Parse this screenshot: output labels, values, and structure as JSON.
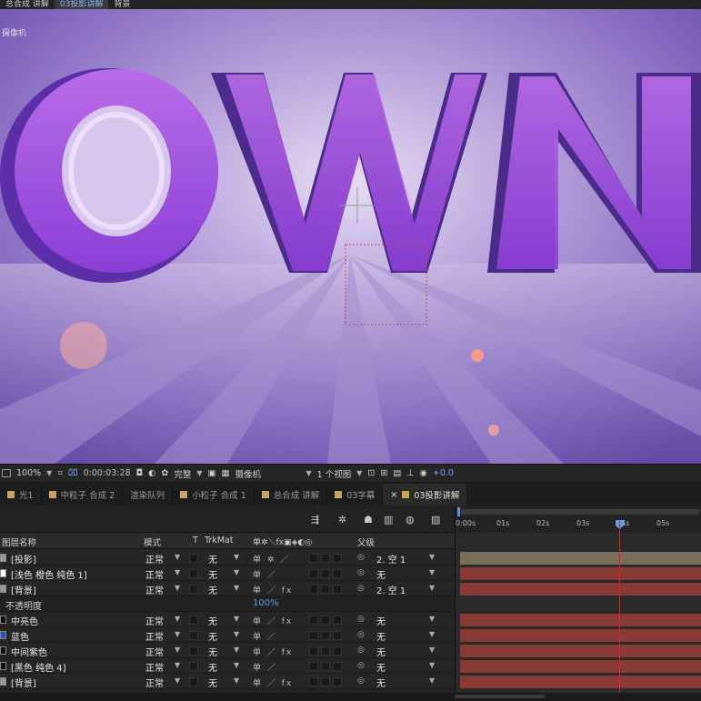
{
  "top_tabs": [
    "总合成 讲解",
    "03投影讲解",
    "背景"
  ],
  "viewer": {
    "label": "摄像机",
    "letters": "OWN"
  },
  "viewer_bar": {
    "zoom": "100%",
    "timecode": "0:00:03:28",
    "resolution": "完整",
    "camera": "摄像机",
    "views": "1 个视图",
    "exposure": "+0.0"
  },
  "tabs": [
    {
      "label": "光1",
      "color": "#c8a45a"
    },
    {
      "label": "中粒子 合成 2",
      "color": "#c8a45a"
    },
    {
      "label": "渲染队列",
      "color": ""
    },
    {
      "label": "小粒子 合成 1",
      "color": "#c8a45a"
    },
    {
      "label": "总合成 讲解",
      "color": "#c8a45a"
    },
    {
      "label": "03字幕",
      "color": "#c8a45a"
    },
    {
      "label": "03投影讲解",
      "color": "#c8a45a"
    }
  ],
  "layer_header": {
    "name": "图层名称",
    "mode": "模式",
    "t": "T",
    "trkmat": "TrkMat",
    "switches": "单✲＼fx▣◈◐◎",
    "parent": "父级"
  },
  "layers": [
    {
      "name": "[投影]",
      "mode": "正常",
      "trkmat": "无",
      "parent": "2. 空 1",
      "switches": "单 ✲ ／",
      "swatch": "#9a9a9a"
    },
    {
      "name": "[浅色 橙色 纯色 1]",
      "mode": "正常",
      "trkmat": "无",
      "parent": "无",
      "switches": "单 ／",
      "swatch": "#ffffff"
    },
    {
      "name": "[背景]",
      "mode": "正常",
      "trkmat": "无",
      "parent": "2. 空 1",
      "switches": "单 ／ fx",
      "swatch": "#9a9a9a"
    },
    {
      "name": "中亮色",
      "mode": "正常",
      "trkmat": "无",
      "parent": "无",
      "switches": "单 ／ fx",
      "swatch": "#111111"
    },
    {
      "name": "蓝色",
      "mode": "正常",
      "trkmat": "无",
      "parent": "无",
      "switches": "单 ／",
      "swatch": "#3050c8"
    },
    {
      "name": "中间紫色",
      "mode": "正常",
      "trkmat": "无",
      "parent": "无",
      "switches": "单 ／ fx",
      "swatch": "#111111"
    },
    {
      "name": "[黑色 纯色 4]",
      "mode": "正常",
      "trkmat": "无",
      "parent": "无",
      "switches": "单 ／",
      "swatch": "#111111"
    },
    {
      "name": "[背景]",
      "mode": "正常",
      "trkmat": "无",
      "parent": "无",
      "switches": "单 ／ fx",
      "swatch": "#9a9a9a"
    }
  ],
  "opacity_row": {
    "label": "不透明度",
    "value": "100%"
  },
  "ruler_ticks": [
    "0:00s",
    "01s",
    "02s",
    "03s",
    "04s",
    "05s"
  ],
  "colors": {
    "accent": "#5b8fd9",
    "playhead": "#dd2233",
    "layer_bar_red": "#8a3a34",
    "layer_bar_tan": "#7a6e58"
  }
}
